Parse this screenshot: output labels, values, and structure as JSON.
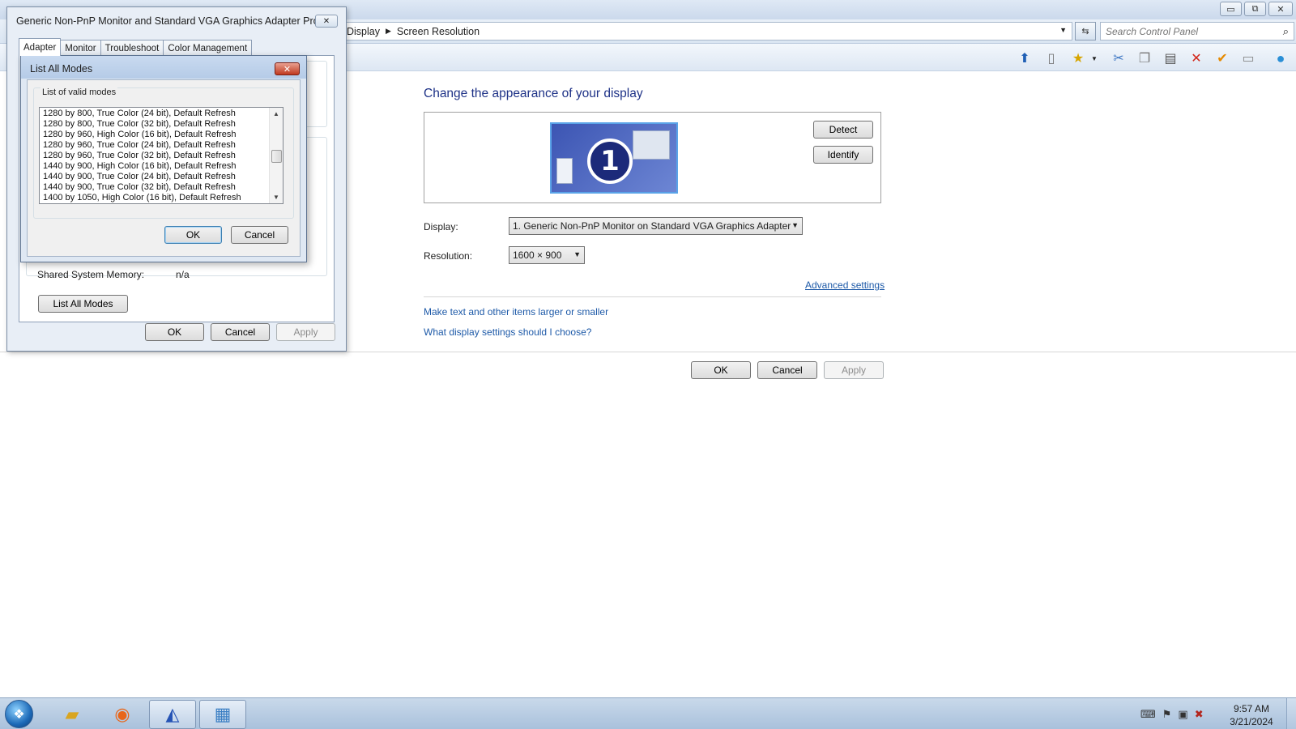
{
  "window": {
    "breadcrumb": [
      "Display",
      "Screen Resolution"
    ],
    "search_placeholder": "Search Control Panel",
    "controls": {
      "minimize": "▭",
      "restore": "⧉",
      "close": "✕"
    },
    "toolbar_icons": [
      "up-arrow-icon",
      "panel-icon",
      "favorites-icon",
      "scissors-icon",
      "copy-icon",
      "paste-icon",
      "delete-icon",
      "check-icon",
      "window-icon",
      "globe-icon"
    ]
  },
  "screen_resolution": {
    "heading": "Change the appearance of your display",
    "monitor_number": "1",
    "detect_label": "Detect",
    "identify_label": "Identify",
    "display_label": "Display:",
    "display_value": "1. Generic Non-PnP Monitor on Standard VGA Graphics Adapter",
    "resolution_label": "Resolution:",
    "resolution_value": "1600 × 900",
    "advanced_link": "Advanced settings",
    "text_size_link": "Make text and other items larger or smaller",
    "help_link": "What display settings should I choose?",
    "ok_label": "OK",
    "cancel_label": "Cancel",
    "apply_label": "Apply"
  },
  "properties_dialog": {
    "title": "Generic Non-PnP Monitor and Standard VGA Graphics Adapter Pro...",
    "close_glyph": "✕",
    "tabs": [
      "Adapter",
      "Monitor",
      "Troubleshoot",
      "Color Management"
    ],
    "active_tab": "Adapter",
    "shared_memory_label": "Shared System Memory:",
    "shared_memory_value": "n/a",
    "list_all_modes_label": "List All Modes",
    "ok_label": "OK",
    "cancel_label": "Cancel",
    "apply_label": "Apply"
  },
  "modes_dialog": {
    "title": "List All Modes",
    "close_glyph": "✕",
    "group_label": "List of valid modes",
    "modes": [
      "1280 by 800, True Color (24 bit), Default Refresh",
      "1280 by 800, True Color (32 bit), Default Refresh",
      "1280 by 960, High Color (16 bit), Default Refresh",
      "1280 by 960, True Color (24 bit), Default Refresh",
      "1280 by 960, True Color (32 bit), Default Refresh",
      "1440 by 900, High Color (16 bit), Default Refresh",
      "1440 by 900, True Color (24 bit), Default Refresh",
      "1440 by 900, True Color (32 bit), Default Refresh",
      "1400 by 1050, High Color (16 bit), Default Refresh"
    ],
    "ok_label": "OK",
    "cancel_label": "Cancel"
  },
  "taskbar": {
    "apps": [
      "file-explorer-icon",
      "firefox-icon",
      "sailing-app-icon",
      "control-panel-icon"
    ],
    "time": "9:57 AM",
    "date": "3/21/2024"
  }
}
